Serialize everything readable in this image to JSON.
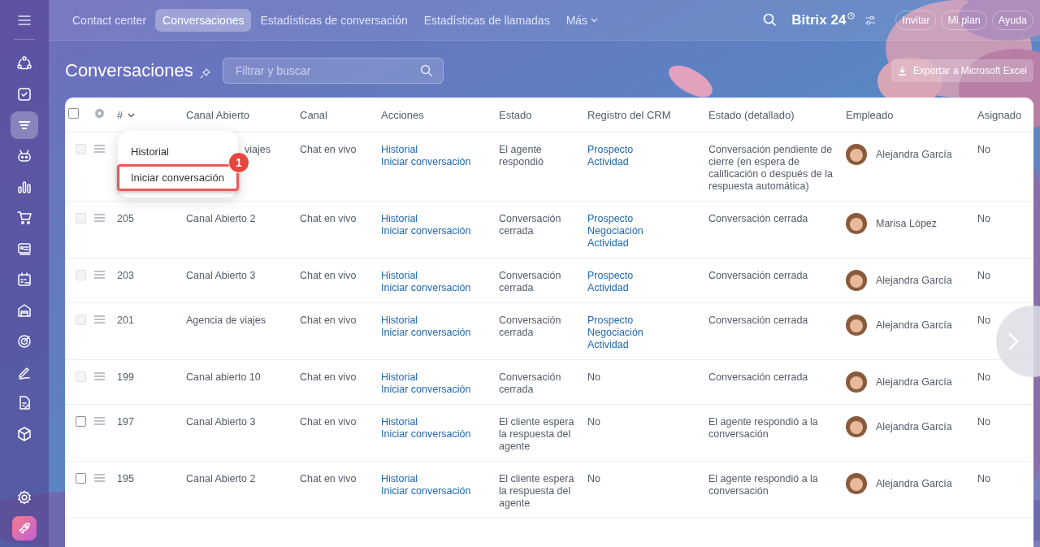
{
  "top_nav": {
    "tabs": [
      {
        "label": "Contact center",
        "selected": false
      },
      {
        "label": "Conversaciones",
        "selected": true
      },
      {
        "label": "Estadísticas de conversación",
        "selected": false
      },
      {
        "label": "Estadísticas de llamadas",
        "selected": false
      },
      {
        "label": "Más",
        "selected": false
      }
    ],
    "logo": "Bitrix",
    "logo_number": "24",
    "buttons": [
      "Invitar",
      "Mi plan",
      "Ayuda"
    ]
  },
  "sidebar": {
    "items": [
      {
        "selected": false
      },
      {
        "selected": false
      },
      {
        "selected": true
      },
      {
        "selected": false
      },
      {
        "selected": false
      },
      {
        "selected": false
      },
      {
        "selected": false
      },
      {
        "selected": false
      },
      {
        "selected": false
      },
      {
        "selected": false
      },
      {
        "selected": false
      },
      {
        "selected": false
      },
      {
        "selected": false
      }
    ]
  },
  "page": {
    "title": "Conversaciones",
    "search": {
      "placeholder": "Filtrar y buscar"
    },
    "export_button": "Exportar a Microsoft Excel"
  },
  "table": {
    "select_all_checked": false,
    "columns": [
      "#",
      "Canal Abierto",
      "Canal",
      "Acciones",
      "Estado",
      "Registro del CRM",
      "Estado (detallado)",
      "Empleado",
      "Asignado"
    ],
    "rows": [
      {
        "disabled": true,
        "number": "",
        "canal_abierto": "viajes",
        "covered": true,
        "canal": "Chat en vivo",
        "actions": [
          "Historial",
          "Iniciar conversación"
        ],
        "estado": "El agente respondió",
        "crm": [
          {
            "text": "Prospecto",
            "link": true
          },
          {
            "text": "Actividad",
            "link": true
          }
        ],
        "detalle": "Conversación pendiente de cierre (en espera de calificación o después de la respuesta automática)",
        "empleado": "Alejandra García",
        "asignado": "No"
      },
      {
        "disabled": true,
        "number": "205",
        "canal_abierto": "Canal Abierto 2",
        "covered": false,
        "canal": "Chat en vivo",
        "actions": [
          "Historial",
          "Iniciar conversación"
        ],
        "estado": "Conversación cerrada",
        "crm": [
          {
            "text": "Prospecto",
            "link": true
          },
          {
            "text": "Negociación",
            "link": true
          },
          {
            "text": "Actividad",
            "link": true
          }
        ],
        "detalle": "Conversación cerrada",
        "empleado": "Marisa López",
        "asignado": "No"
      },
      {
        "disabled": true,
        "number": "203",
        "canal_abierto": "Canal Abierto 3",
        "covered": false,
        "canal": "Chat en vivo",
        "actions": [
          "Historial",
          "Iniciar conversación"
        ],
        "estado": "Conversación cerrada",
        "crm": [
          {
            "text": "Prospecto",
            "link": true
          },
          {
            "text": "Actividad",
            "link": true
          }
        ],
        "detalle": "Conversación cerrada",
        "empleado": "Alejandra García",
        "asignado": "No"
      },
      {
        "disabled": true,
        "number": "201",
        "canal_abierto": "Agencia de viajes",
        "covered": false,
        "canal": "Chat en vivo",
        "actions": [
          "Historial",
          "Iniciar conversación"
        ],
        "estado": "Conversación cerrada",
        "crm": [
          {
            "text": "Prospecto",
            "link": true
          },
          {
            "text": "Negociación",
            "link": true
          },
          {
            "text": "Actividad",
            "link": true
          }
        ],
        "detalle": "Conversación cerrada",
        "empleado": "Alejandra García",
        "asignado": "No"
      },
      {
        "disabled": true,
        "number": "199",
        "canal_abierto": "Canal abierto 10",
        "covered": false,
        "canal": "Chat en vivo",
        "actions": [
          "Historial",
          "Iniciar conversación"
        ],
        "estado": "Conversación cerrada",
        "crm": [
          {
            "text": "No",
            "link": false
          }
        ],
        "detalle": "Conversación cerrada",
        "empleado": "Alejandra García",
        "asignado": "No"
      },
      {
        "disabled": false,
        "number": "197",
        "canal_abierto": "Canal Abierto 3",
        "covered": false,
        "canal": "Chat en vivo",
        "actions": [
          "Historial",
          "Iniciar conversación"
        ],
        "estado": "El cliente espera la respuesta del agente",
        "crm": [
          {
            "text": "No",
            "link": false
          }
        ],
        "detalle": "El agente respondió a la conversación",
        "empleado": "Alejandra García",
        "asignado": "No"
      },
      {
        "disabled": false,
        "number": "195",
        "canal_abierto": "Canal Abierto 2",
        "covered": false,
        "canal": "Chat en vivo",
        "actions": [
          "Historial",
          "Iniciar conversación"
        ],
        "estado": "El cliente espera la respuesta del agente",
        "crm": [
          {
            "text": "No",
            "link": false
          }
        ],
        "detalle": "El agente respondió a la conversación",
        "empleado": "Alejandra García",
        "asignado": "No"
      }
    ]
  },
  "context_menu": {
    "items": [
      {
        "label": "Historial",
        "selected": false
      },
      {
        "label": "Iniciar conversación",
        "selected": true
      }
    ],
    "step_badge": "1"
  }
}
